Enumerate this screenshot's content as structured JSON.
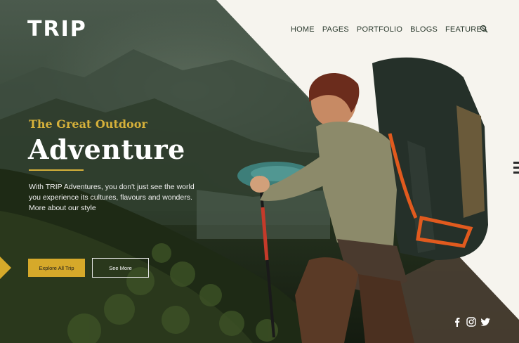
{
  "brand": {
    "logo": "TRIP"
  },
  "nav": {
    "items": [
      "HOME",
      "PAGES",
      "PORTFOLIO",
      "BLOGS",
      "FEATURES"
    ],
    "search_icon": "search-icon"
  },
  "hero": {
    "eyebrow": "The Great Outdoor",
    "headline": "Adventure",
    "description_lines": [
      "With TRIP Adventures, you don't just see the world",
      "you experience its cultures, flavours and wonders.",
      "More about our style"
    ],
    "primary_button": "Explore All Trip",
    "secondary_button": "See More"
  },
  "social": [
    "facebook-icon",
    "instagram-icon",
    "twitter-icon"
  ],
  "colors": {
    "accent": "#d6a92a",
    "eyebrow": "#d6b13a",
    "panel": "#f6f4ee",
    "nav_text": "#2b3a2e"
  }
}
